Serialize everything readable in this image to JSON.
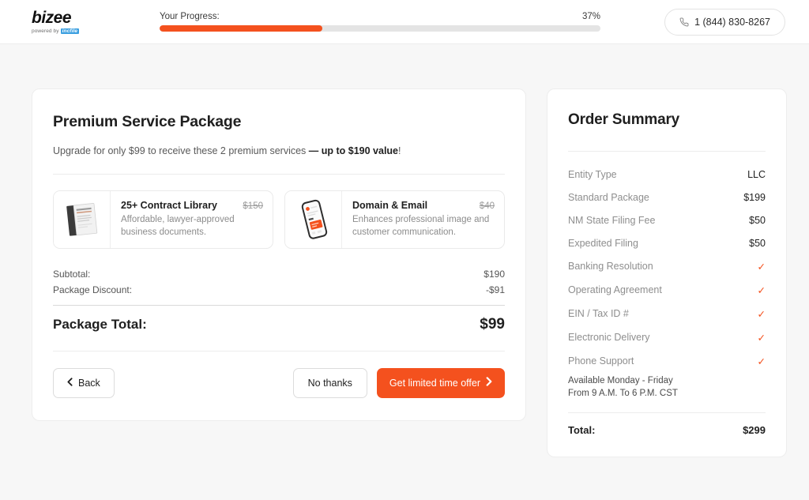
{
  "header": {
    "logo_word": "bizee",
    "logo_powered_prefix": "powered by",
    "logo_brand": "incfile",
    "progress_label": "Your Progress:",
    "progress_percent_label": "37%",
    "progress_percent_value": 37,
    "phone_number": "1 (844) 830-8267",
    "phone_icon": "phone-handset-icon",
    "accent_color": "#f4511e",
    "track_color": "#e4e4e4"
  },
  "main": {
    "title": "Premium Service Package",
    "subtitle_plain": "Upgrade for only $99 to receive these 2 premium services ",
    "subtitle_bold": "— up to $190 value",
    "subtitle_tail": "!",
    "offers": [
      {
        "name": "25+ Contract Library",
        "price": "$150",
        "description": "Affordable, lawyer-approved business documents.",
        "icon": "document-stack-icon"
      },
      {
        "name": "Domain & Email",
        "price": "$40",
        "description": "Enhances professional image and customer communication.",
        "icon": "smartphone-icon"
      }
    ],
    "totals": [
      {
        "label": "Subtotal:",
        "value": "$190"
      },
      {
        "label": "Package Discount:",
        "value": "-$91"
      }
    ],
    "grand_total_label": "Package Total:",
    "grand_total_value": "$99",
    "buttons": {
      "back": "Back",
      "no_thanks": "No thanks",
      "cta": "Get limited time offer"
    }
  },
  "order_summary": {
    "title": "Order Summary",
    "rows": [
      {
        "label": "Entity Type",
        "value": "LLC",
        "type": "text"
      },
      {
        "label": "Standard Package",
        "value": "$199",
        "type": "text"
      },
      {
        "label": "NM State Filing Fee",
        "value": "$50",
        "type": "text"
      },
      {
        "label": "Expedited Filing",
        "value": "$50",
        "type": "text"
      },
      {
        "label": "Banking Resolution",
        "value": "✓",
        "type": "check"
      },
      {
        "label": "Operating Agreement",
        "value": "✓",
        "type": "check"
      },
      {
        "label": "EIN / Tax ID #",
        "value": "✓",
        "type": "check"
      },
      {
        "label": "Electronic Delivery",
        "value": "✓",
        "type": "check"
      },
      {
        "label": "Phone Support",
        "value": "✓",
        "type": "check"
      }
    ],
    "note_line1": "Available Monday - Friday",
    "note_line2": "From 9 A.M. To 6 P.M. CST",
    "total_label": "Total:",
    "total_value": "$299"
  }
}
